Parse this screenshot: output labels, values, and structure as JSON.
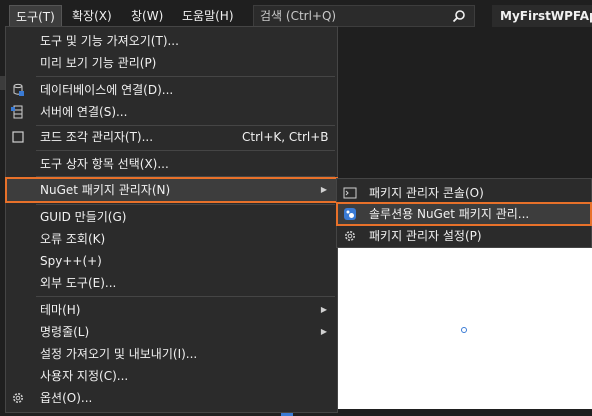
{
  "menubar": {
    "items": [
      "도구(T)",
      "확장(X)",
      "창(W)",
      "도움말(H)"
    ],
    "search_placeholder": "검색 (Ctrl+Q)",
    "app_title": "MyFirstWPFApp"
  },
  "tools_menu": {
    "items": [
      {
        "label": "도구 및 기능 가져오기(T)..."
      },
      {
        "label": "미리 보기 기능 관리(P)"
      },
      {
        "label": "데이터베이스에 연결(D)...",
        "icon": "database-connect-icon"
      },
      {
        "label": "서버에 연결(S)...",
        "icon": "server-connect-icon"
      },
      {
        "label": "코드 조각 관리자(T)...",
        "icon": "code-snippet-icon",
        "shortcut": "Ctrl+K, Ctrl+B"
      },
      {
        "label": "도구 상자 항목 선택(X)..."
      },
      {
        "label": "NuGet 패키지 관리자(N)",
        "submenu": true,
        "highlighted": true
      },
      {
        "label": "GUID 만들기(G)"
      },
      {
        "label": "오류 조회(K)"
      },
      {
        "label": "Spy++(+)"
      },
      {
        "label": "외부 도구(E)..."
      },
      {
        "label": "테마(H)",
        "submenu": true
      },
      {
        "label": "명령줄(L)",
        "submenu": true
      },
      {
        "label": "설정 가져오기 및 내보내기(I)..."
      },
      {
        "label": "사용자 지정(C)..."
      },
      {
        "label": "옵션(O)...",
        "icon": "gear-icon"
      }
    ]
  },
  "nuget_submenu": {
    "items": [
      {
        "label": "패키지 관리자 콘솔(O)",
        "icon": "console-icon"
      },
      {
        "label": "솔루션용 NuGet 패키지 관리...",
        "icon": "nuget-icon",
        "highlighted": true
      },
      {
        "label": "패키지 관리자 설정(P)",
        "icon": "gear-icon"
      }
    ]
  },
  "colors": {
    "menu_bg": "#2b2b2b",
    "highlight_outline": "#e8712a",
    "accent_blue": "#3a7bd5"
  }
}
